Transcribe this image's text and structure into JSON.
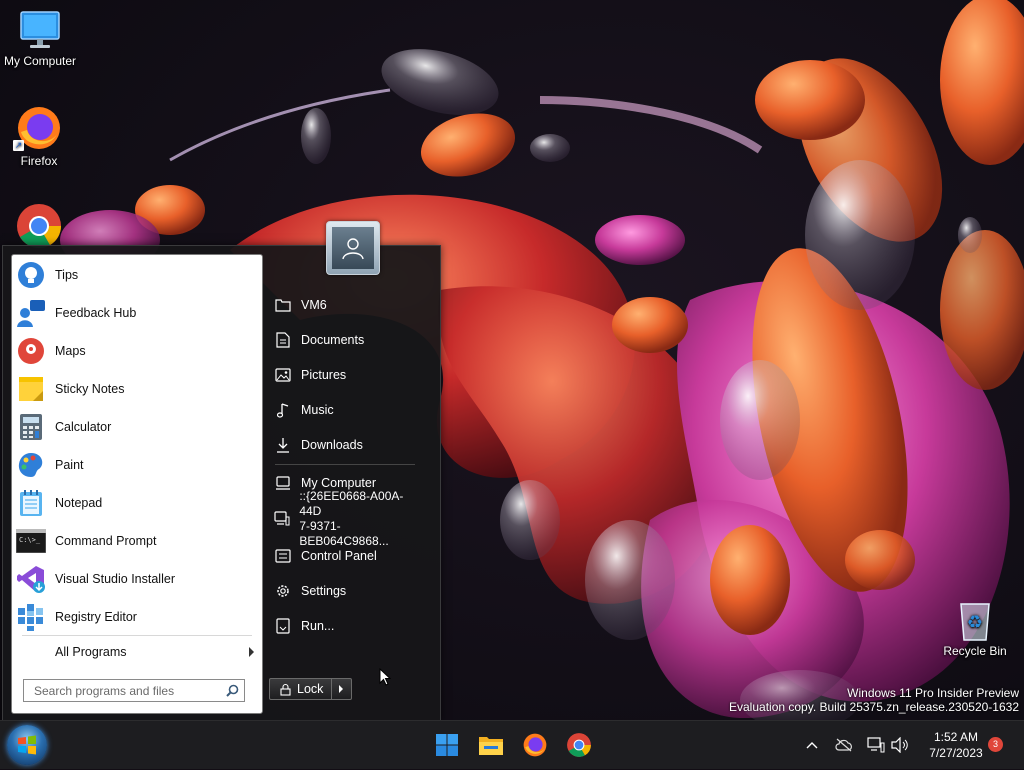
{
  "desktop": {
    "icons": [
      {
        "label": "My Computer",
        "icon": "monitor-icon"
      },
      {
        "label": "Firefox",
        "icon": "firefox-icon"
      },
      {
        "label": "",
        "icon": "chrome-icon"
      },
      {
        "label": "Recycle Bin",
        "icon": "recycle-bin-icon"
      }
    ]
  },
  "start_menu": {
    "programs": [
      {
        "label": "Tips",
        "icon": "tips-icon"
      },
      {
        "label": "Feedback Hub",
        "icon": "feedback-hub-icon"
      },
      {
        "label": "Maps",
        "icon": "maps-icon"
      },
      {
        "label": "Sticky Notes",
        "icon": "sticky-notes-icon"
      },
      {
        "label": "Calculator",
        "icon": "calculator-icon"
      },
      {
        "label": "Paint",
        "icon": "paint-icon"
      },
      {
        "label": "Notepad",
        "icon": "notepad-icon"
      },
      {
        "label": "Command Prompt",
        "icon": "command-prompt-icon"
      },
      {
        "label": "Visual Studio Installer",
        "icon": "visual-studio-installer-icon"
      },
      {
        "label": "Registry Editor",
        "icon": "registry-editor-icon"
      }
    ],
    "all_programs_label": "All Programs",
    "search_placeholder": "Search programs and files",
    "places": [
      {
        "label": "VM6",
        "icon": "user-folder-icon"
      },
      {
        "label": "Documents",
        "icon": "documents-icon"
      },
      {
        "label": "Pictures",
        "icon": "pictures-icon"
      },
      {
        "label": "Music",
        "icon": "music-icon"
      },
      {
        "label": "Downloads",
        "icon": "downloads-icon"
      },
      {
        "label": "My Computer",
        "icon": "computer-icon"
      },
      {
        "label_line1": "::{26EE0668-A00A-44D",
        "label_line2": "7-9371-BEB064C9868...",
        "icon": "network-computer-icon"
      },
      {
        "label": "Control Panel",
        "icon": "control-panel-icon"
      },
      {
        "label": "Settings",
        "icon": "settings-gear-icon"
      },
      {
        "label": "Run...",
        "icon": "run-icon"
      }
    ],
    "lock_label": "Lock"
  },
  "watermark": {
    "line1": "Windows 11 Pro Insider Preview",
    "line2": "Evaluation copy. Build 25375.zn_release.230520-1632"
  },
  "taskbar": {
    "apps": [
      "windows-start-icon",
      "file-explorer-icon",
      "firefox-icon",
      "chrome-icon"
    ],
    "time": "1:52 AM",
    "date": "7/27/2023",
    "notification_count": "3"
  },
  "colors": {
    "accent_blue": "#0078d4",
    "taskbar_bg": "#1d1d20",
    "menu_bg": "#161618",
    "badge_red": "#e0463a"
  }
}
